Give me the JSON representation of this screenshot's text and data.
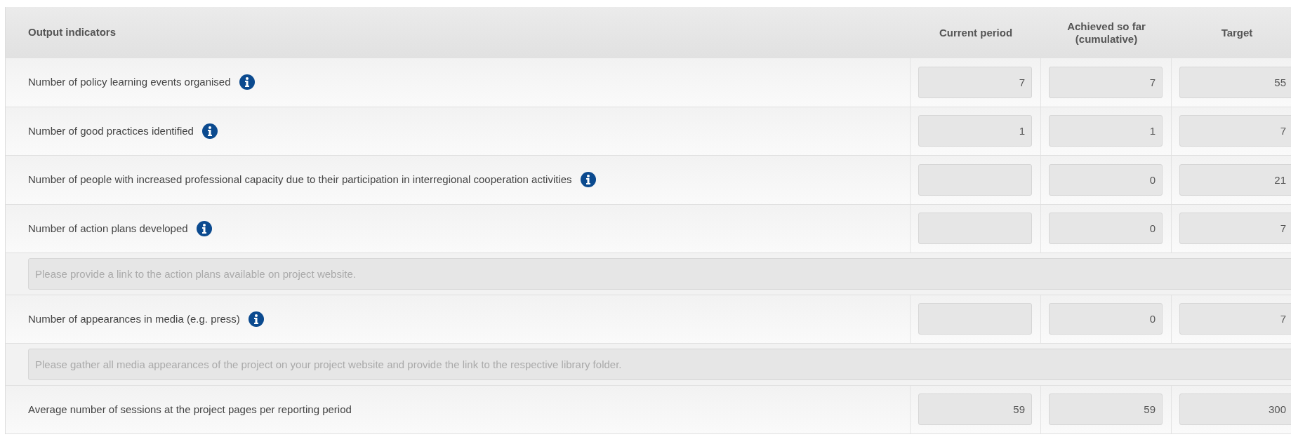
{
  "table": {
    "columns": [
      "Output indicators",
      "Current period",
      "Achieved so far (cumulative)",
      "Target"
    ],
    "rows": [
      {
        "kind": "indicator",
        "label": "Number of policy learning events organised",
        "info": true,
        "current": "7",
        "achieved": "7",
        "target": "55"
      },
      {
        "kind": "indicator",
        "label": "Number of good practices identified",
        "info": true,
        "current": "1",
        "achieved": "1",
        "target": "7"
      },
      {
        "kind": "indicator",
        "label": "Number of people with increased professional capacity due to their participation in interregional cooperation activities",
        "info": true,
        "achieved": "0",
        "target": "21"
      },
      {
        "kind": "indicator",
        "label": "Number of action plans developed",
        "info": true,
        "achieved": "0",
        "target": "7"
      },
      {
        "kind": "note",
        "placeholder": "Please provide a link to the action plans available on project website."
      },
      {
        "kind": "indicator",
        "label": "Number of appearances in media (e.g. press)",
        "info": true,
        "achieved": "0",
        "target": "7"
      },
      {
        "kind": "note",
        "placeholder": "Please gather all media appearances of the project on your project website and provide the link to the respective library folder."
      },
      {
        "kind": "indicator",
        "label": "Average number of sessions at the project pages per reporting period",
        "info": false,
        "current": "59",
        "achieved": "59",
        "target": "300"
      }
    ]
  }
}
